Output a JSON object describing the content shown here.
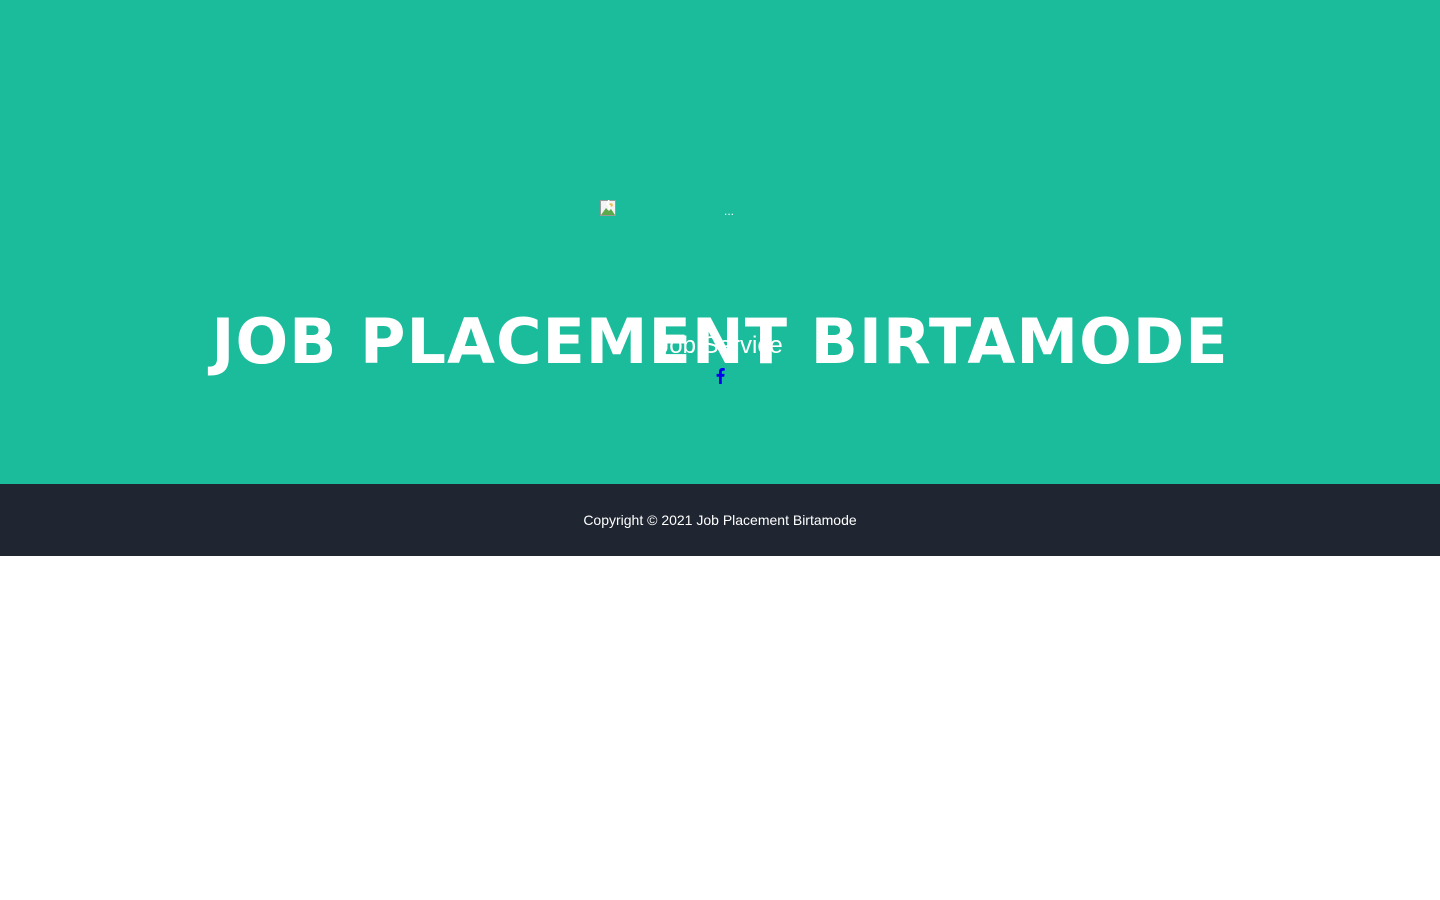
{
  "masthead": {
    "logo_alt": "...",
    "title": "JOB PLACEMENT BIRTAMODE",
    "subtitle": "Job Service",
    "social_icon": "facebook-icon"
  },
  "footer": {
    "copyright": "Copyright © 2021 Job Placement Birtamode"
  },
  "colors": {
    "masthead_bg": "#1abc9c",
    "footer_bg": "#1f2631",
    "text": "#ffffff",
    "social_link": "#0000ee",
    "page_bg": "#ffffff"
  }
}
